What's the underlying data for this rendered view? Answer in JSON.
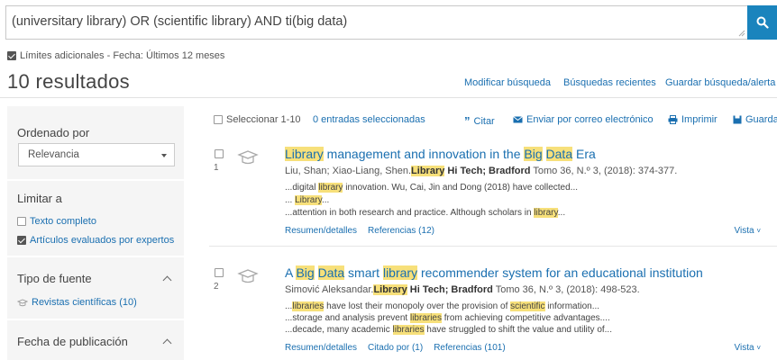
{
  "search": {
    "query": "(universitary library) OR (scientific library) AND ti(big data)"
  },
  "limits": {
    "label": "Límites adicionales - Fecha: Últimos 12 meses"
  },
  "results_count": "10 resultados",
  "top_links": {
    "modify": "Modificar búsqueda",
    "recent": "Búsquedas recientes",
    "save": "Guardar búsqueda/alerta"
  },
  "sidebar": {
    "sort_title": "Ordenado por",
    "sort_value": "Relevancia",
    "limit_title": "Limitar a",
    "full_text": "Texto completo",
    "peer_reviewed": "Artículos evaluados por expertos",
    "source_type_title": "Tipo de fuente",
    "source_type_item": "Revistas científicas (10)",
    "pub_date_title": "Fecha de publicación"
  },
  "toolbar": {
    "select": "Seleccionar 1-10",
    "selected": "0 entradas seleccionadas",
    "cite": "Citar",
    "email": "Enviar por correo electrónico",
    "print": "Imprimir",
    "save": "Guardar"
  },
  "results": [
    {
      "num": "1",
      "title": [
        {
          "t": "Library",
          "h": true
        },
        {
          "t": " management and innovation in the ",
          "h": false
        },
        {
          "t": "Big",
          "h": true
        },
        {
          "t": " ",
          "h": false
        },
        {
          "t": "Data",
          "h": true
        },
        {
          "t": " Era",
          "h": false
        }
      ],
      "meta": [
        {
          "t": "Liu, Shan; Xiao-Liang, Shen.",
          "b": false,
          "h": false
        },
        {
          "t": "Library",
          "b": true,
          "h": true
        },
        {
          "t": " Hi Tech; Bradford",
          "b": true,
          "h": false
        },
        {
          "t": " Tomo 36, N.º 3,  (2018): 374-377.",
          "b": false,
          "h": false
        }
      ],
      "snippets": [
        [
          {
            "t": "...digital ",
            "h": false
          },
          {
            "t": "library",
            "h": true
          },
          {
            "t": " innovation. Wu, Cai, Jin and Dong (2018) have collected...",
            "h": false
          }
        ],
        [
          {
            "t": "... ",
            "h": false
          },
          {
            "t": "Library",
            "h": true
          },
          {
            "t": "...",
            "h": false
          }
        ],
        [
          {
            "t": "...attention in both research and practice. Although scholars in ",
            "h": false
          },
          {
            "t": "library",
            "h": true
          },
          {
            "t": "...",
            "h": false
          }
        ]
      ],
      "links": [
        "Resumen/detalles",
        "Referencias (12)"
      ],
      "vista": "Vista"
    },
    {
      "num": "2",
      "title": [
        {
          "t": "A ",
          "h": false
        },
        {
          "t": "Big",
          "h": true
        },
        {
          "t": " ",
          "h": false
        },
        {
          "t": "Data",
          "h": true
        },
        {
          "t": " smart ",
          "h": false
        },
        {
          "t": "library",
          "h": true
        },
        {
          "t": " recommender system for an educational institution",
          "h": false
        }
      ],
      "meta": [
        {
          "t": "Simović Aleksandar.",
          "b": false,
          "h": false
        },
        {
          "t": "Library",
          "b": true,
          "h": true
        },
        {
          "t": " Hi Tech; Bradford",
          "b": true,
          "h": false
        },
        {
          "t": " Tomo 36, N.º 3,  (2018): 498-523.",
          "b": false,
          "h": false
        }
      ],
      "snippets": [
        [
          {
            "t": "...",
            "h": false
          },
          {
            "t": "libraries",
            "h": true
          },
          {
            "t": " have lost their monopoly over the provision of ",
            "h": false
          },
          {
            "t": "scientific",
            "h": true
          },
          {
            "t": " information...",
            "h": false
          }
        ],
        [
          {
            "t": "...storage and analysis prevent ",
            "h": false
          },
          {
            "t": "libraries",
            "h": true
          },
          {
            "t": " from achieving competitive advantages....",
            "h": false
          }
        ],
        [
          {
            "t": "...decade, many academic ",
            "h": false
          },
          {
            "t": "libraries",
            "h": true
          },
          {
            "t": " have struggled to shift the value and utility of...",
            "h": false
          }
        ]
      ],
      "links": [
        "Resumen/detalles",
        "Citado por (1)",
        "Referencias (101)"
      ],
      "vista": "Vista"
    }
  ],
  "colors": {
    "accent": "#1a84bd",
    "link": "#1a6fb0",
    "highlight": "#f7e07a"
  }
}
